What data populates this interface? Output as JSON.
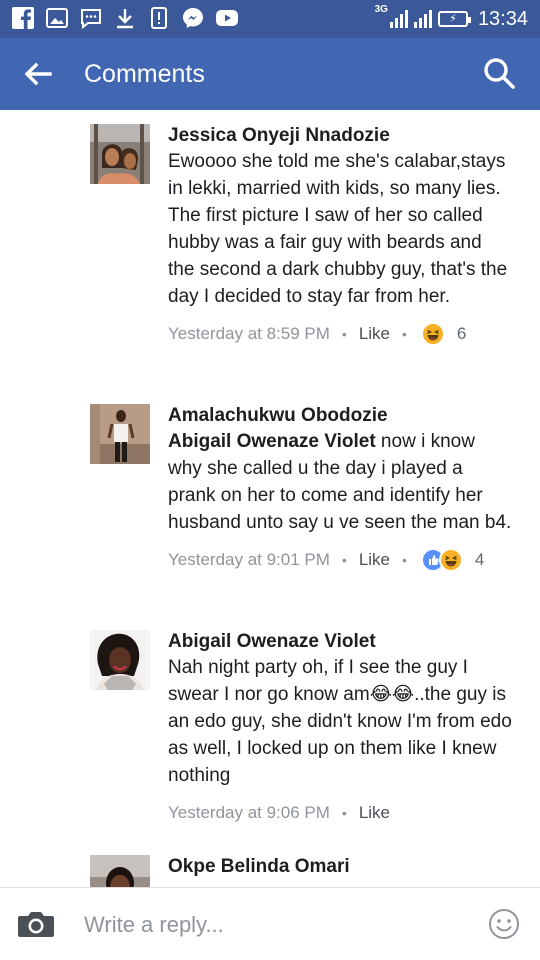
{
  "status_bar": {
    "network": "3G",
    "time": "13:34",
    "icons": [
      "facebook-icon",
      "gallery-icon",
      "messenger-chat-icon",
      "download-icon",
      "alert-icon",
      "messenger-icon",
      "youtube-icon"
    ]
  },
  "app_bar": {
    "title": "Comments",
    "color": "#4267b2"
  },
  "comments": [
    {
      "author": "Jessica Onyeji Nnadozie",
      "mention": "",
      "text": "Ewoooo she told me she's calabar,stays in lekki, married with kids, so many lies.  The first picture I saw of her so called hubby was a fair guy with beards and the second a dark chubby guy, that's the day I decided  to stay far from her.",
      "time": "Yesterday at 8:59 PM",
      "like_label": "Like",
      "reactions": [
        "haha"
      ],
      "reaction_count": "6"
    },
    {
      "author": "Amalachukwu Obodozie",
      "mention": "Abigail Owenaze Violet",
      "text": " now i know why she called u the day i played a prank on her to come and identify her husband unto say u ve seen the man b4.",
      "time": "Yesterday at 9:01 PM",
      "like_label": "Like",
      "reactions": [
        "like",
        "haha"
      ],
      "reaction_count": "4"
    },
    {
      "author": "Abigail Owenaze Violet",
      "mention": "",
      "text": "Nah night party oh, if I see the guy I swear I nor go know am😂😂..the guy is an edo guy, she didn't know I'm from edo as well, I locked up on them like I knew nothing",
      "time": "Yesterday at 9:06 PM",
      "like_label": "Like",
      "reactions": [],
      "reaction_count": ""
    },
    {
      "author": "Okpe Belinda Omari",
      "mention": "",
      "text": "",
      "time": "",
      "like_label": "",
      "reactions": [],
      "reaction_count": ""
    }
  ],
  "reply_bar": {
    "placeholder": "Write a reply..."
  }
}
